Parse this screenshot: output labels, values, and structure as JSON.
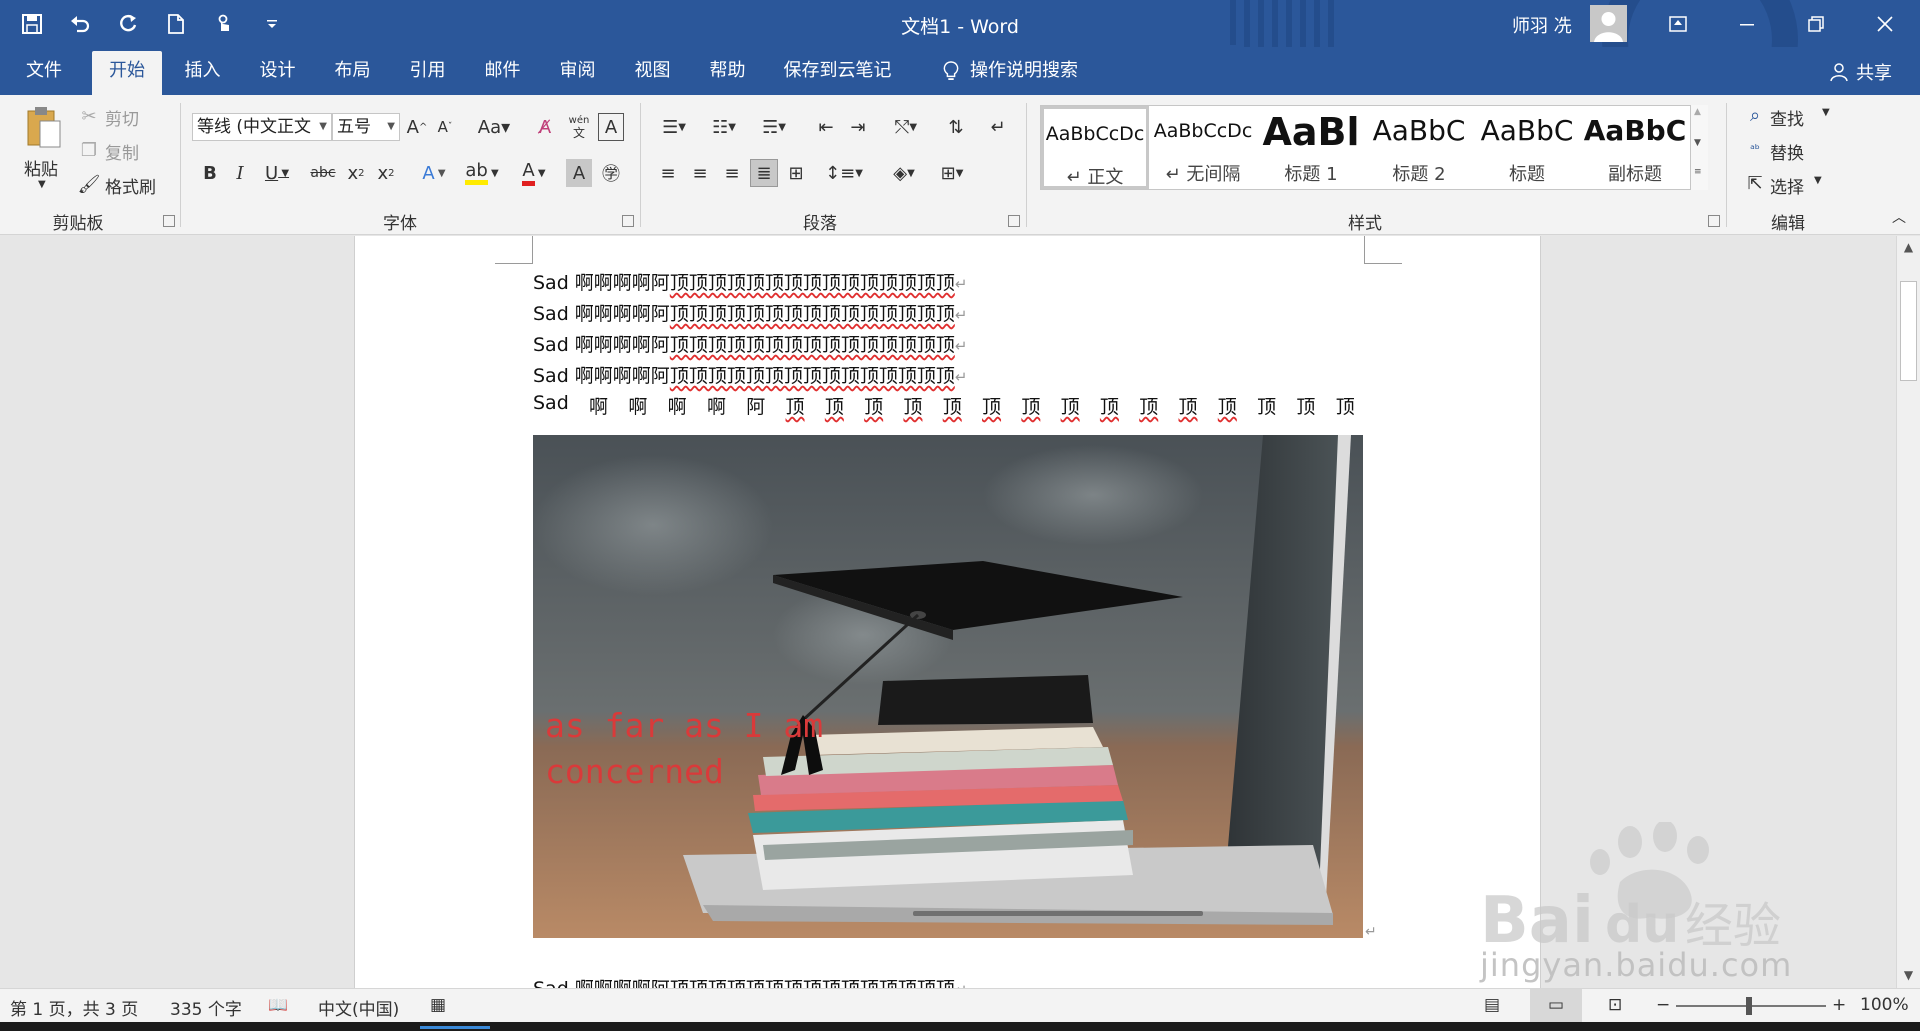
{
  "window": {
    "title": "文档1  -  Word",
    "user_name": "师羽 冼"
  },
  "tabs": [
    "文件",
    "开始",
    "插入",
    "设计",
    "布局",
    "引用",
    "邮件",
    "审阅",
    "视图",
    "帮助",
    "保存到云笔记",
    "操作说明搜索"
  ],
  "active_tab": "开始",
  "share_label": "共享",
  "ribbon": {
    "clipboard": {
      "label": "剪贴板",
      "paste": "粘贴",
      "cut": "剪切",
      "copy": "复制",
      "format_painter": "格式刷"
    },
    "font": {
      "label": "字体",
      "font_name": "等线 (中文正文",
      "font_size": "五号"
    },
    "paragraph": {
      "label": "段落"
    },
    "styles": {
      "label": "样式",
      "items": [
        {
          "sample": "AaBbCcDc",
          "name": "↵ 正文"
        },
        {
          "sample": "AaBbCcDc",
          "name": "↵ 无间隔"
        },
        {
          "sample": "AaBl",
          "name": "标题 1"
        },
        {
          "sample": "AaBbC",
          "name": "标题 2"
        },
        {
          "sample": "AaBbC",
          "name": "标题"
        },
        {
          "sample": "AaBbC",
          "name": "副标题"
        }
      ]
    },
    "editing": {
      "label": "编辑",
      "find": "查找",
      "replace": "替换",
      "select": "选择"
    }
  },
  "document": {
    "lines": [
      {
        "prefix": "Sad 啊啊啊啊阿",
        "underlined": "顶顶顶顶顶顶顶顶顶顶顶顶顶顶顶"
      },
      {
        "prefix": "Sad 啊啊啊啊阿",
        "underlined": "顶顶顶顶顶顶顶顶顶顶顶顶顶顶顶"
      },
      {
        "prefix": "Sad 啊啊啊啊阿",
        "underlined": "顶顶顶顶顶顶顶顶顶顶顶顶顶顶顶"
      },
      {
        "prefix": "Sad 啊啊啊啊阿",
        "underlined": "顶顶顶顶顶顶顶顶顶顶顶顶顶顶顶"
      }
    ],
    "justified_line": [
      "Sad",
      "啊",
      "啊",
      "啊",
      "啊",
      "阿",
      "顶",
      "顶",
      "顶",
      "顶",
      "顶",
      "顶",
      "顶",
      "顶",
      "顶",
      "顶",
      "顶",
      "顶",
      "顶",
      "顶",
      "顶"
    ],
    "image_caption_line1": "as far as I am",
    "image_caption_line2": "concerned",
    "last_line": {
      "prefix": "Sad 啊啊啊啊阿",
      "underlined": "顶顶顶顶顶顶顶顶顶顶顶顶顶顶顶"
    }
  },
  "statusbar": {
    "page": "第 1 页，共 3 页",
    "words": "335 个字",
    "language": "中文(中国)",
    "zoom": "100%"
  },
  "watermark": {
    "text": "jingyan.baidu.com"
  },
  "colors": {
    "titlebar": "#2b579a",
    "ribbon": "#f3f3f3",
    "caption": "#d93a3a",
    "spell_underline": "#e03030"
  }
}
